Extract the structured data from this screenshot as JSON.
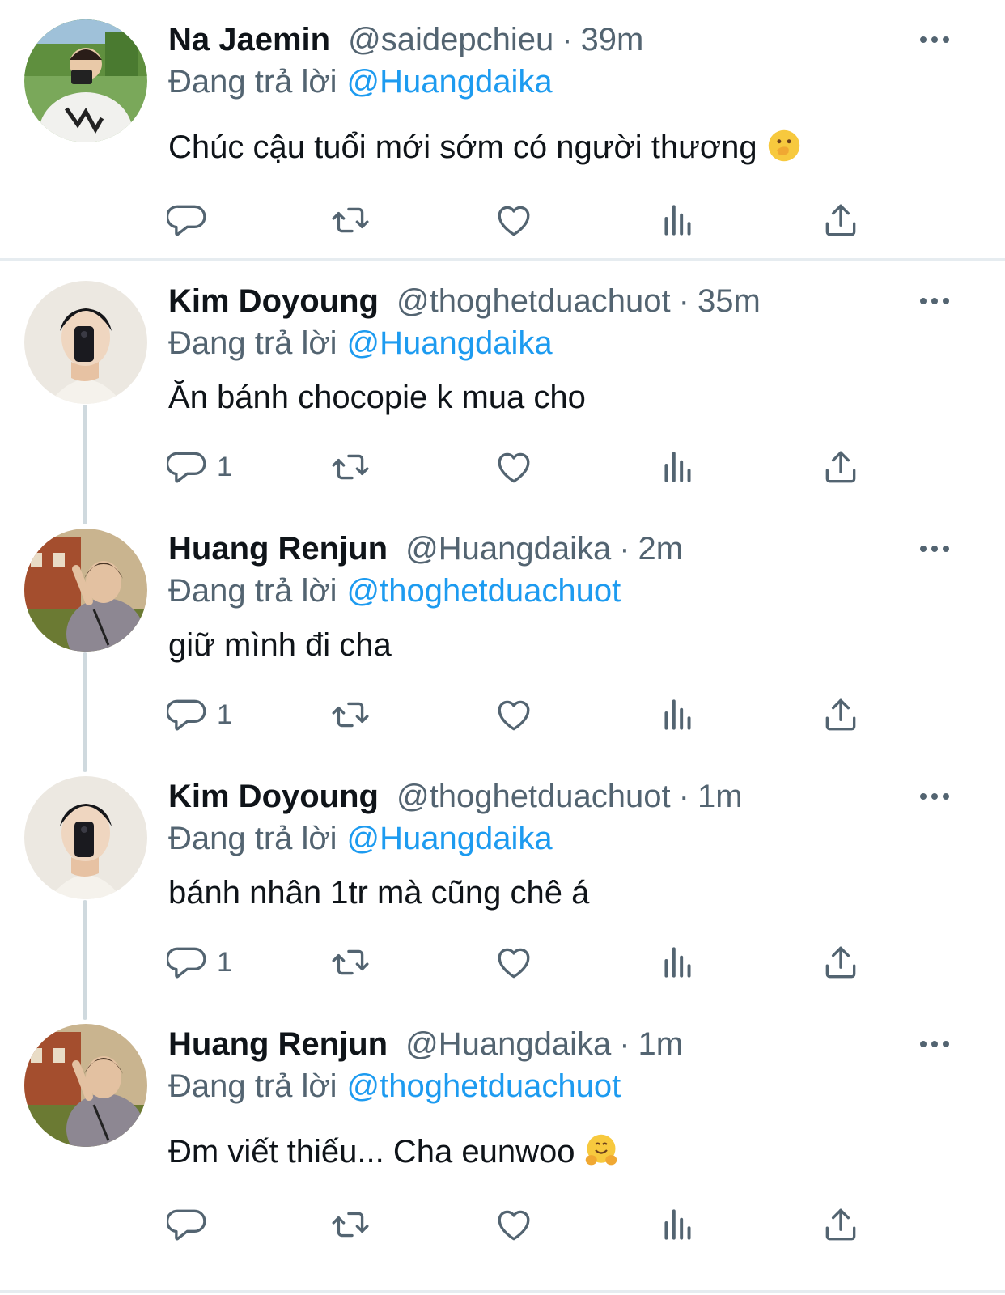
{
  "tweets": [
    {
      "name": "Na Jaemin",
      "handle": "@saidepchieu",
      "dot": "·",
      "time": "39m",
      "reply_prefix": "Đang trả lời",
      "reply_to": "@Huangdaika",
      "text": "Chúc cậu tuổi mới sớm có người thương",
      "emoji": "face-with-hand-over-mouth",
      "reply_count": ""
    },
    {
      "name": "Kim Doyoung",
      "handle": "@thoghetduachuot",
      "dot": "·",
      "time": "35m",
      "reply_prefix": "Đang trả lời",
      "reply_to": "@Huangdaika",
      "text": "Ăn bánh chocopie k mua cho",
      "reply_count": "1"
    },
    {
      "name": "Huang Renjun",
      "handle": "@Huangdaika",
      "dot": "·",
      "time": "2m",
      "reply_prefix": "Đang trả lời",
      "reply_to": "@thoghetduachuot",
      "text": "giữ mình đi cha",
      "reply_count": "1"
    },
    {
      "name": "Kim Doyoung",
      "handle": "@thoghetduachuot",
      "dot": "·",
      "time": "1m",
      "reply_prefix": "Đang trả lời",
      "reply_to": "@Huangdaika",
      "text": "bánh nhân 1tr mà cũng chê á",
      "reply_count": "1"
    },
    {
      "name": "Huang Renjun",
      "handle": "@Huangdaika",
      "dot": "·",
      "time": "1m",
      "reply_prefix": "Đang trả lời",
      "reply_to": "@thoghetduachuot",
      "text": "Đm viết thiếu... Cha eunwoo",
      "emoji": "hugging-face",
      "reply_count": ""
    }
  ],
  "icons": {
    "more": "more-dots-icon",
    "reply": "reply-bubble-icon",
    "retweet": "retweet-icon",
    "like": "heart-icon",
    "views": "analytics-bars-icon",
    "share": "share-upload-icon"
  },
  "colors": {
    "text": "#0f1419",
    "secondary": "#536471",
    "link": "#1d9bf0",
    "thread_line": "#cfd9de",
    "divider": "#e6ecf0"
  }
}
